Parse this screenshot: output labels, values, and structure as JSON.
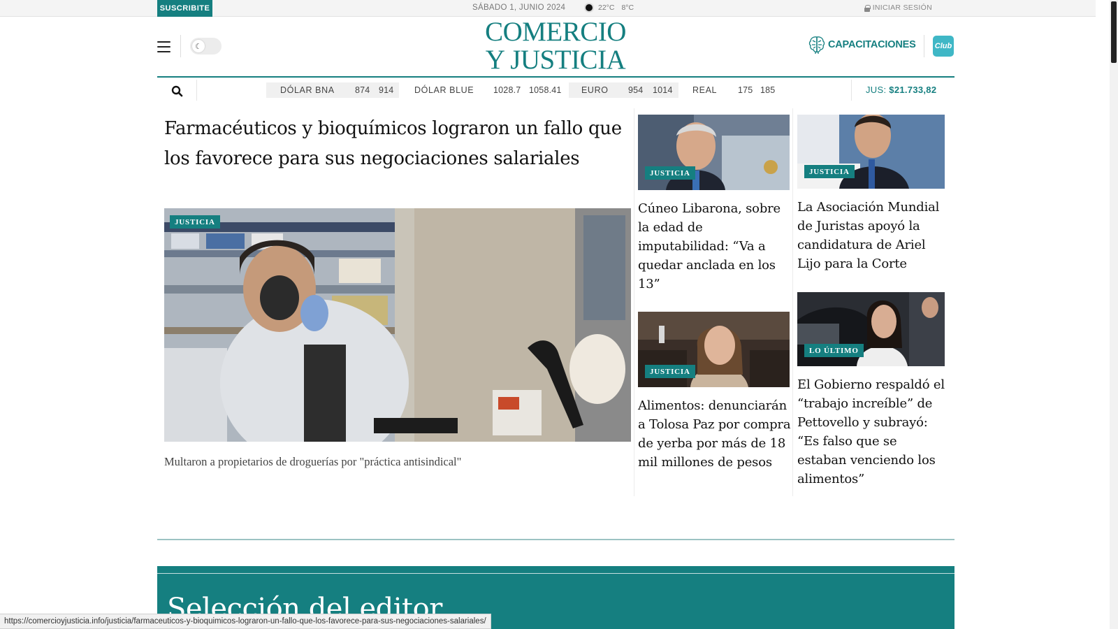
{
  "topbar": {
    "subscribe_label": "SUSCRIBITE",
    "date": "SÁBADO 1, JUNIO 2024",
    "temp_max": "22°C",
    "temp_min": "8°C",
    "login_label": "INICIAR SESIÓN"
  },
  "header": {
    "logo_line1": "COMERCIO",
    "logo_line2": "Y JUSTICIA",
    "capacitaciones_label": "CAPACITACIONES",
    "club_label": "Club"
  },
  "currencies": [
    {
      "name": "DÓLAR BNA",
      "buy": "874",
      "sell": "914"
    },
    {
      "name": "DÓLAR BLUE",
      "buy": "1028.7",
      "sell": "1058.41"
    },
    {
      "name": "EURO",
      "buy": "954",
      "sell": "1014"
    },
    {
      "name": "REAL",
      "buy": "175",
      "sell": "185"
    }
  ],
  "jus": {
    "label": "JUS:",
    "value": "$21.733,82"
  },
  "main_story": {
    "title": "Farmacéuticos y bioquímicos lograron un fallo que los favorece para sus negociaciones salariales",
    "badge": "JUSTICIA",
    "caption": "Multaron a propietarios de droguerías por \"práctica antisindical\""
  },
  "cards": [
    {
      "badge": "JUSTICIA",
      "title": "Cúneo Libarona, sobre la edad de imputabilidad: “Va a quedar anclada en los 13”"
    },
    {
      "badge": "JUSTICIA",
      "title": "La Asociación Mundial de Juristas apoyó la candidatura de Ariel Lijo para la Corte"
    },
    {
      "badge": "JUSTICIA",
      "title": "Alimentos: denunciarán a Tolosa Paz por compra de yerba por más de 18 mil millones de pesos"
    },
    {
      "badge": "LO ÚLTIMO",
      "title": "El Gobierno respaldó el “trabajo increíble” de Pettovello y subrayó: “Es falso que se estaban venciendo los alimentos”"
    }
  ],
  "editor_section": {
    "title": "Selección del editor"
  },
  "status_url": "https://comercioyjusticia.info/justicia/farmaceuticos-y-bioquimicos-lograron-un-fallo-que-los-favorece-para-sus-negociaciones-salariales/",
  "colors": {
    "brand": "#157f80",
    "club": "#3fb7c6"
  }
}
